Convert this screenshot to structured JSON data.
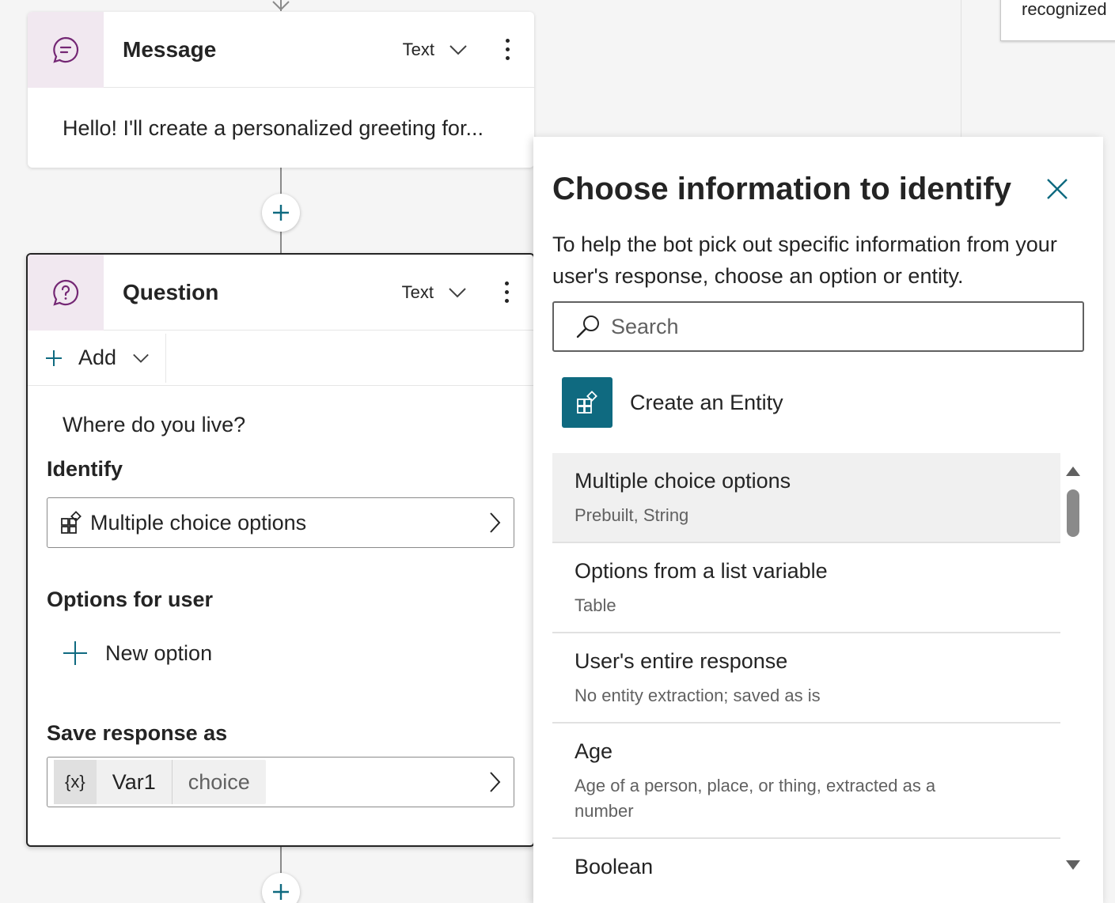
{
  "message_node": {
    "title": "Message",
    "type_label": "Text",
    "body_text": "Hello! I'll create a personalized greeting for..."
  },
  "question_node": {
    "title": "Question",
    "type_label": "Text",
    "add_label": "Add",
    "question_text": "Where do you live?",
    "identify_label": "Identify",
    "identify_value": "Multiple choice options",
    "options_label": "Options for user",
    "new_option_label": "New option",
    "save_label": "Save response as",
    "var_icon": "{x}",
    "var_name": "Var1",
    "var_type": "choice"
  },
  "partial_node": {
    "text": "recognized"
  },
  "flyout": {
    "title": "Choose information to identify",
    "description": "To help the bot pick out specific information from your user's response, choose an option or entity.",
    "search_placeholder": "Search",
    "create_entity_label": "Create an Entity",
    "options": [
      {
        "name": "Multiple choice options",
        "detail": "Prebuilt, String",
        "selected": true
      },
      {
        "name": "Options from a list variable",
        "detail": "Table",
        "selected": false
      },
      {
        "name": "User's entire response",
        "detail": "No entity extraction; saved as is",
        "selected": false
      },
      {
        "name": "Age",
        "detail": "Age of a person, place, or thing, extracted as a number",
        "selected": false
      },
      {
        "name": "Boolean",
        "detail": "",
        "selected": false
      }
    ]
  },
  "colors": {
    "accent_teal": "#0f6a80",
    "node_icon_bg": "#f1e8f0",
    "node_icon_purple": "#742774",
    "selected_option_bg": "#f0f0f0"
  }
}
